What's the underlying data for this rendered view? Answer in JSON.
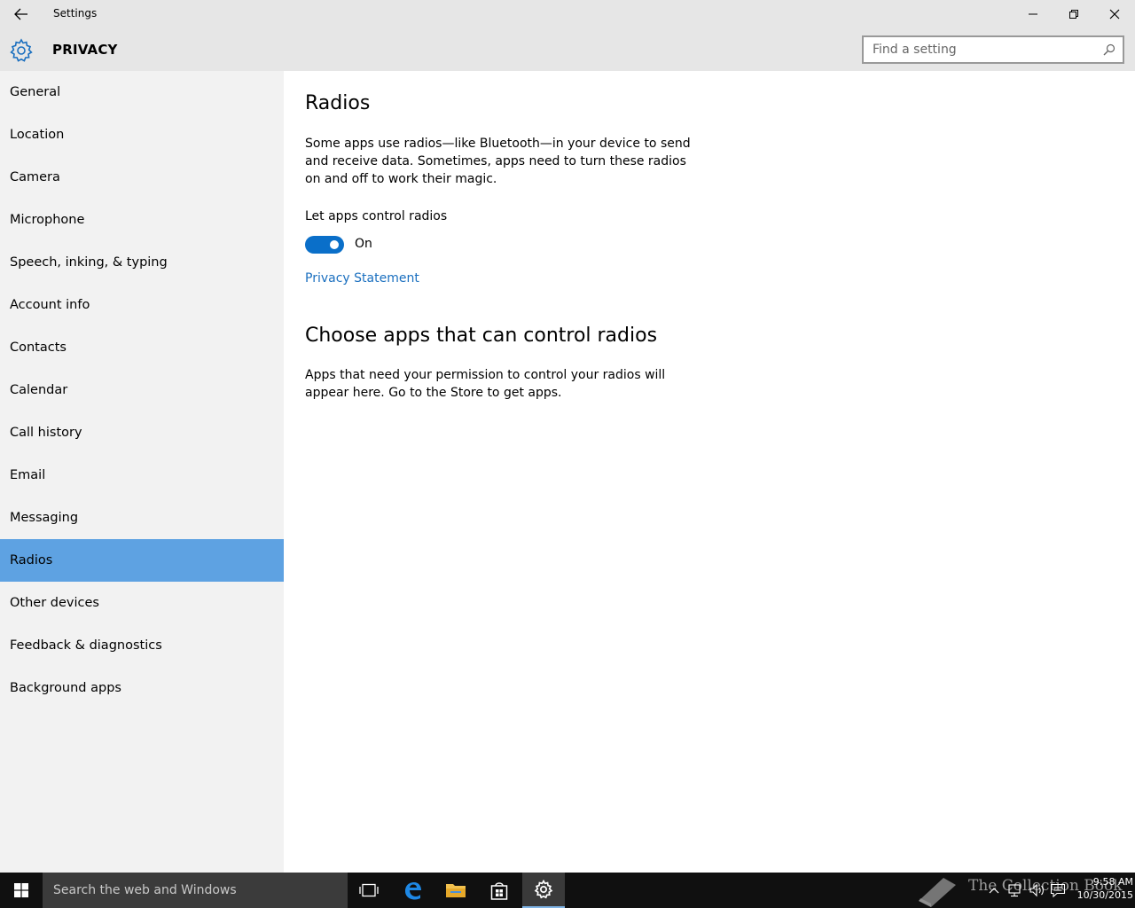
{
  "window": {
    "title": "Settings"
  },
  "header": {
    "section": "PRIVACY",
    "search_placeholder": "Find a setting"
  },
  "sidebar": {
    "items": [
      {
        "label": "General"
      },
      {
        "label": "Location"
      },
      {
        "label": "Camera"
      },
      {
        "label": "Microphone"
      },
      {
        "label": "Speech, inking, & typing"
      },
      {
        "label": "Account info"
      },
      {
        "label": "Contacts"
      },
      {
        "label": "Calendar"
      },
      {
        "label": "Call history"
      },
      {
        "label": "Email"
      },
      {
        "label": "Messaging"
      },
      {
        "label": "Radios"
      },
      {
        "label": "Other devices"
      },
      {
        "label": "Feedback & diagnostics"
      },
      {
        "label": "Background apps"
      }
    ],
    "selected": "Radios"
  },
  "main": {
    "title": "Radios",
    "description": "Some apps use radios—like Bluetooth—in your device to send and receive data. Sometimes, apps need to turn these radios on and off to work their magic.",
    "toggle_label": "Let apps control radios",
    "toggle_state": "On",
    "toggle_on": true,
    "privacy_link": "Privacy Statement",
    "section2_title": "Choose apps that can control radios",
    "section2_text": "Apps that need your permission to control your radios will appear here. Go to the Store to get apps."
  },
  "taskbar": {
    "search_placeholder": "Search the web and Windows",
    "time": "9:58 AM",
    "date": "10/30/2015",
    "watermark": "The Collection Book"
  },
  "colors": {
    "accent": "#0a6fc9",
    "selected_nav": "#5ea2e2",
    "link": "#1a6fbf",
    "chrome": "#e6e6e6",
    "sidebar": "#f2f2f2",
    "taskbar": "#101010"
  }
}
